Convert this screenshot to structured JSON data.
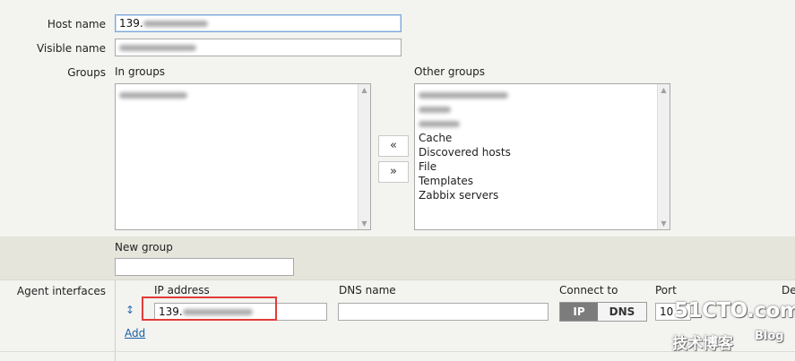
{
  "form": {
    "host_name_label": "Host name",
    "host_name_value": "139.",
    "visible_name_label": "Visible name",
    "visible_name_value": "",
    "groups_label": "Groups",
    "in_groups_label": "In groups",
    "other_groups_label": "Other groups",
    "in_groups": [
      ""
    ],
    "other_groups": [
      "",
      "",
      "",
      "Cache",
      "Discovered hosts",
      "File",
      "Templates",
      "Zabbix servers"
    ],
    "move_left_label": "«",
    "move_right_label": "»",
    "new_group_label": "New group",
    "new_group_value": ""
  },
  "interfaces": {
    "label": "Agent interfaces",
    "ip_header": "IP address",
    "dns_header": "DNS name",
    "connect_header": "Connect to",
    "port_header": "Port",
    "default_header": "De",
    "ip_value": "139.",
    "dns_value": "",
    "connect_ip": "IP",
    "connect_dns": "DNS",
    "port_value": "10",
    "add_link": "Add"
  },
  "watermark": {
    "site": "51CTO.com",
    "chinese": "技术博客",
    "blog": "Blog"
  },
  "colors": {
    "accent_link": "#1a5fa8",
    "highlight_box": "#e23b3b",
    "band": "#e6e5dc"
  }
}
